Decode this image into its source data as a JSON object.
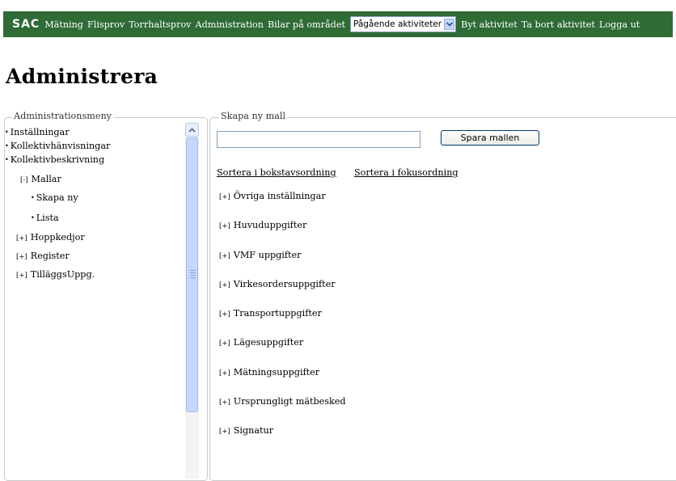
{
  "topbar": {
    "logo": "SAC",
    "nav_items": [
      "Mätning",
      "Flisprov",
      "Torrhaltsprov",
      "Administration",
      "Bilar på området"
    ],
    "activity_select": "Pågående aktiviteter",
    "actions": [
      "Byt aktivitet",
      "Ta bort aktivitet",
      "Logga ut"
    ],
    "nav_color": "#2e6b35"
  },
  "page_title": "Administrera",
  "menu": {
    "legend": "Administrationsmeny",
    "items": [
      {
        "label": "Inställningar",
        "marker": "•"
      },
      {
        "label": "Kollektivhänvisningar",
        "marker": "•"
      },
      {
        "label": "Kollektivbeskrivning",
        "marker": "•"
      },
      {
        "label": "Mallar",
        "marker": "[-]"
      },
      {
        "label": "Skapa ny",
        "marker": "•"
      },
      {
        "label": "Lista",
        "marker": "•"
      },
      {
        "label": "Hoppkedjor",
        "marker": "[+]"
      },
      {
        "label": "Register",
        "marker": "[+]"
      },
      {
        "label": "TilläggsUppg.",
        "marker": "[+]"
      }
    ]
  },
  "main": {
    "legend": "Skapa ny mall",
    "input_value": "",
    "save_button": "Spara mallen",
    "sort_alpha": "Sortera i bokstavsordning",
    "sort_focus": "Sortera i fokusordning",
    "sections": [
      "Övriga inställningar",
      "Huvuduppgifter",
      "VMF uppgifter",
      "Virkesordersuppgifter",
      "Transportuppgifter",
      "Lägesuppgifter",
      "Mätningsuppgifter",
      "Ursprungligt mätbesked",
      "Signatur"
    ],
    "section_marker": "[+]"
  }
}
